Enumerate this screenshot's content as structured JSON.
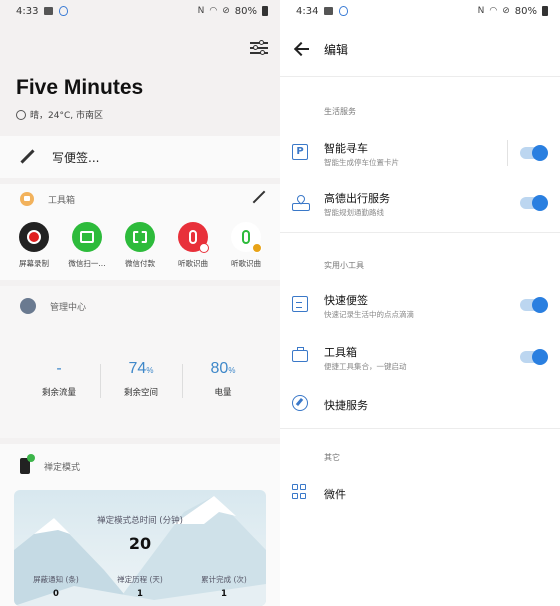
{
  "left": {
    "status": {
      "time": "4:33",
      "battery": "80%"
    },
    "title": "Five Minutes",
    "weather": "晴，24°C, 市南区",
    "note_placeholder": "写便签...",
    "toolbox": {
      "header": "工具箱",
      "tools": [
        {
          "label": "屏幕录制",
          "color": "#222222",
          "icon": "record-icon"
        },
        {
          "label": "微信扫一...",
          "color": "#2dbb3b",
          "icon": "scan-icon"
        },
        {
          "label": "微信付款",
          "color": "#2dbb3b",
          "icon": "pay-icon"
        },
        {
          "label": "听歌识曲",
          "color": "#e8303a",
          "icon": "music-icon"
        },
        {
          "label": "听歌识曲",
          "color": "#ffffff",
          "icon": "music-recognize-icon"
        }
      ]
    },
    "management": {
      "header": "管理中心",
      "stats": [
        {
          "value": "-",
          "unit": "",
          "caption": "剩余流量"
        },
        {
          "value": "74",
          "unit": "%",
          "caption": "剩余空间"
        },
        {
          "value": "80",
          "unit": "%",
          "caption": "电量"
        }
      ]
    },
    "focus": {
      "header": "禅定模式",
      "total_caption": "禅定模式总时间 (分钟)",
      "total_value": "20",
      "stats": [
        {
          "caption": "屏蔽通知 (条)",
          "value": "0"
        },
        {
          "caption": "禅定历程 (天)",
          "value": "1"
        },
        {
          "caption": "累计完成 (次)",
          "value": "1"
        }
      ]
    }
  },
  "right": {
    "status": {
      "time": "4:34",
      "battery": "80%"
    },
    "page_title": "编辑",
    "groups": [
      {
        "label": "生活服务",
        "items": [
          {
            "title": "智能寻车",
            "subtitle": "智能生成停车位置卡片",
            "icon": "parking-icon",
            "toggle": true
          },
          {
            "title": "高德出行服务",
            "subtitle": "智能规划通勤路线",
            "icon": "route-icon",
            "toggle": true
          }
        ]
      },
      {
        "label": "实用小工具",
        "items": [
          {
            "title": "快速便签",
            "subtitle": "快速记录生活中的点点滴滴",
            "icon": "note-icon",
            "toggle": true
          },
          {
            "title": "工具箱",
            "subtitle": "便捷工具集合，一键启动",
            "icon": "toolbox-icon",
            "toggle": true
          },
          {
            "title": "快捷服务",
            "subtitle": "",
            "icon": "compass-icon",
            "toggle": false
          }
        ]
      },
      {
        "label": "其它",
        "items": [
          {
            "title": "微件",
            "subtitle": "",
            "icon": "widget-icon",
            "toggle": false
          }
        ]
      }
    ],
    "colors": {
      "accent": "#2a7fe0"
    }
  }
}
